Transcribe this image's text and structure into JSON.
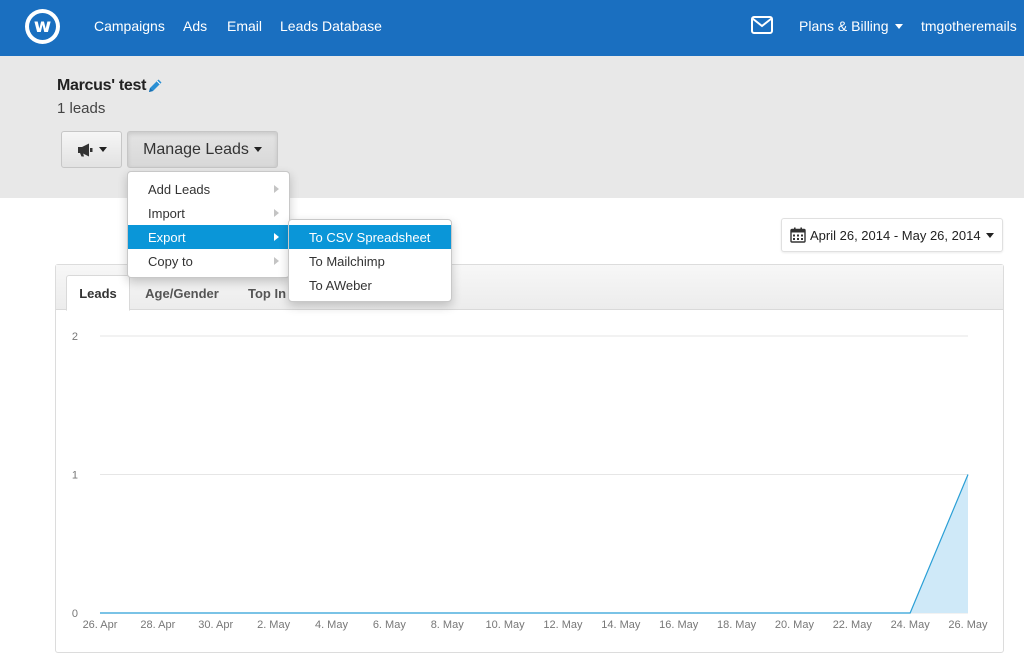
{
  "navbar": {
    "logo_letter": "w",
    "links": [
      "Campaigns",
      "Ads",
      "Email",
      "Leads Database"
    ],
    "plans_billing": "Plans & Billing",
    "username": "tmgotheremails",
    "brand_color": "#1a6fc0"
  },
  "list": {
    "title": "Marcus' test",
    "count": "1 leads"
  },
  "toolbar": {
    "megaphone_icon": "megaphone-icon",
    "manage_label": "Manage Leads"
  },
  "date_range": {
    "label": "April 26, 2014 - May 26, 2014"
  },
  "tabs": [
    "Leads",
    "Age/Gender",
    "Top In"
  ],
  "manage_menu": {
    "items": [
      "Add Leads",
      "Import",
      "Export",
      "Copy to"
    ],
    "active": "Export",
    "highlight_color": "#0a96d8"
  },
  "export_menu": {
    "items": [
      "To CSV Spreadsheet",
      "To Mailchimp",
      "To AWeber"
    ],
    "active": "To CSV Spreadsheet"
  },
  "chart_data": {
    "type": "area",
    "x": [
      "26. Apr",
      "28. Apr",
      "30. Apr",
      "2. May",
      "4. May",
      "6. May",
      "8. May",
      "10. May",
      "12. May",
      "14. May",
      "16. May",
      "18. May",
      "20. May",
      "22. May",
      "24. May",
      "26. May"
    ],
    "series": [
      {
        "values": [
          0,
          0,
          0,
          0,
          0,
          0,
          0,
          0,
          0,
          0,
          0,
          0,
          0,
          0,
          0,
          1
        ]
      }
    ],
    "y_ticks": [
      0,
      1,
      2
    ],
    "ylim": [
      0,
      2
    ],
    "line_color": "#2a9fd6",
    "fill_color": "#cfe9f8"
  }
}
